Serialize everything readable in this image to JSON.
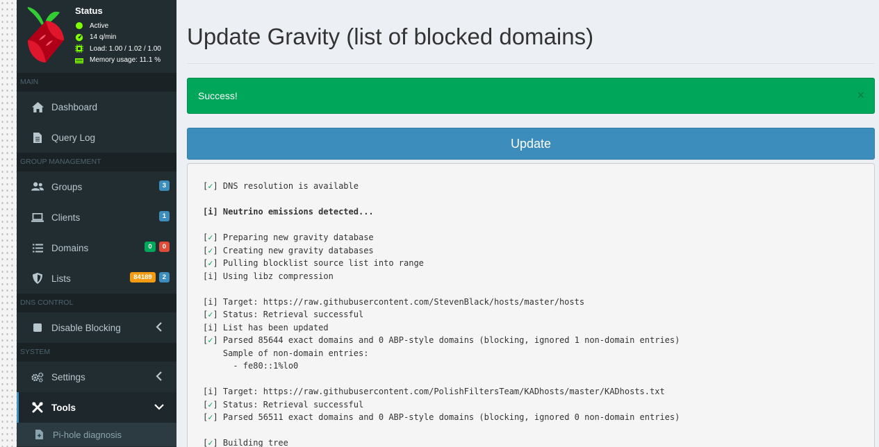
{
  "status": {
    "title": "Status",
    "active": "Active",
    "queries": "14 q/min",
    "load": "Load: 1.00 / 1.02 / 1.00",
    "memory": "Memory usage: 11.1 %"
  },
  "sidebar": {
    "main_header": "MAIN",
    "dashboard": "Dashboard",
    "query_log": "Query Log",
    "group_header": "GROUP MANAGEMENT",
    "groups": {
      "label": "Groups",
      "badge": "3"
    },
    "clients": {
      "label": "Clients",
      "badge": "1"
    },
    "domains": {
      "label": "Domains",
      "badge_allow": "0",
      "badge_deny": "0"
    },
    "lists": {
      "label": "Lists",
      "badge_domains": "84189",
      "badge_lists": "2"
    },
    "dns_header": "DNS CONTROL",
    "disable_blocking": "Disable Blocking",
    "system_header": "SYSTEM",
    "settings": "Settings",
    "tools": "Tools",
    "pihole_diagnosis": "Pi-hole diagnosis"
  },
  "main": {
    "title": "Update Gravity (list of blocked domains)",
    "alert_text": "Success!",
    "alert_close": "×",
    "update_button": "Update"
  },
  "output_lines": [
    {
      "prefix": "[",
      "mark": "✓",
      "suffix": "] DNS resolution is available",
      "bold": false
    },
    {
      "text": "",
      "bold": false
    },
    {
      "text": "[i] Neutrino emissions detected...",
      "bold": true
    },
    {
      "text": "",
      "bold": false
    },
    {
      "prefix": "[",
      "mark": "✓",
      "suffix": "] Preparing new gravity database",
      "bold": false
    },
    {
      "prefix": "[",
      "mark": "✓",
      "suffix": "] Creating new gravity databases",
      "bold": false
    },
    {
      "prefix": "[",
      "mark": "✓",
      "suffix": "] Pulling blocklist source list into range",
      "bold": false
    },
    {
      "text": "[i] Using libz compression",
      "bold": false
    },
    {
      "text": "",
      "bold": false
    },
    {
      "text": "[i] Target: https://raw.githubusercontent.com/StevenBlack/hosts/master/hosts",
      "bold": false
    },
    {
      "prefix": "[",
      "mark": "✓",
      "suffix": "] Status: Retrieval successful",
      "bold": false
    },
    {
      "text": "[i] List has been updated",
      "bold": false
    },
    {
      "prefix": "[",
      "mark": "✓",
      "suffix": "] Parsed 85644 exact domains and 0 ABP-style domains (blocking, ignored 1 non-domain entries)",
      "bold": false
    },
    {
      "text": "    Sample of non-domain entries:",
      "bold": false
    },
    {
      "text": "      - fe80::1%lo0",
      "bold": false
    },
    {
      "text": "",
      "bold": false
    },
    {
      "text": "[i] Target: https://raw.githubusercontent.com/PolishFiltersTeam/KADhosts/master/KADhosts.txt",
      "bold": false
    },
    {
      "prefix": "[",
      "mark": "✓",
      "suffix": "] Status: Retrieval successful",
      "bold": false
    },
    {
      "prefix": "[",
      "mark": "✓",
      "suffix": "] Parsed 56511 exact domains and 0 ABP-style domains (blocking, ignored 0 non-domain entries)",
      "bold": false
    },
    {
      "text": "",
      "bold": false
    },
    {
      "prefix": "[",
      "mark": "✓",
      "suffix": "] Building tree",
      "bold": false
    }
  ],
  "colors": {
    "sidebar_bg": "#222d32",
    "success": "#00a65a",
    "primary": "#3c8dbc",
    "danger": "#dd4b39",
    "warning": "#f39c12"
  },
  "icons": {
    "logo": "pihole-logo",
    "dashboard": "home-icon",
    "query_log": "file-icon",
    "groups": "users-icon",
    "clients": "laptop-icon",
    "domains": "list-icon",
    "lists": "shield-icon",
    "disable_blocking": "stop-icon",
    "settings": "gears-icon",
    "tools": "tools-icon",
    "diagnosis": "file-medical-icon"
  }
}
